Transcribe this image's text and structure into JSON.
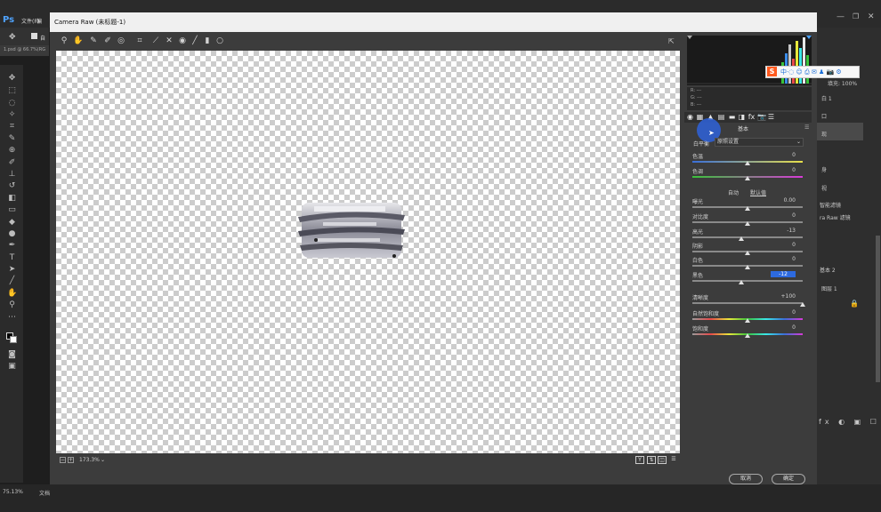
{
  "ps": {
    "logo": "Ps",
    "menu_file": "文件(F)",
    "menu_edit": "编",
    "opt_auto": "自",
    "doc_tab": "1.psd @ 66.7%(RG",
    "zoom": "75.13%",
    "doc_info": "文档",
    "right_panels": {
      "fill_label": "填充: 100%",
      "layer_1": "白 1",
      "item_2": "口",
      "item_3": "现",
      "item_4": "身",
      "item_5": "视",
      "smart_filter": "智能滤镜",
      "camera_raw_filter": "ra Raw 滤镜",
      "basic_2": "基本 2",
      "layer_group": "图层 1"
    }
  },
  "dialog": {
    "title": "Camera Raw (未标题-1)",
    "zoom_value": "173.3%",
    "cancel": "取消",
    "ok": "确定"
  },
  "readout": {
    "r": "R:",
    "g": "G:",
    "b": "B:",
    "dash": "---"
  },
  "panel": {
    "title": "基本",
    "wb_label": "白平衡",
    "wb_value": "原照设置",
    "auto": "自动",
    "default": "默认值",
    "sliders": {
      "temp": {
        "label": "色温",
        "value": "0",
        "pos": 0.5
      },
      "tint": {
        "label": "色调",
        "value": "0",
        "pos": 0.5
      },
      "exposure": {
        "label": "曝光",
        "value": "0.00",
        "pos": 0.5
      },
      "contrast": {
        "label": "对比度",
        "value": "0",
        "pos": 0.5
      },
      "highlights": {
        "label": "高光",
        "value": "-13",
        "pos": 0.44
      },
      "shadows": {
        "label": "阴影",
        "value": "0",
        "pos": 0.5
      },
      "whites": {
        "label": "白色",
        "value": "0",
        "pos": 0.5
      },
      "blacks": {
        "label": "黑色",
        "value": "-12",
        "pos": 0.44
      },
      "clarity": {
        "label": "清晰度",
        "value": "+100",
        "pos": 1.0
      },
      "vibrance": {
        "label": "自然饱和度",
        "value": "0",
        "pos": 0.5
      },
      "saturation": {
        "label": "饱和度",
        "value": "0",
        "pos": 0.5
      }
    }
  },
  "ime": {
    "logo": "S",
    "text": "中·◌ ☺ ⎙ ✉ ♟ 📷 ⚙"
  },
  "colors": {
    "accent": "#2d6adf",
    "cursor_highlight": "#2f5fd0"
  }
}
